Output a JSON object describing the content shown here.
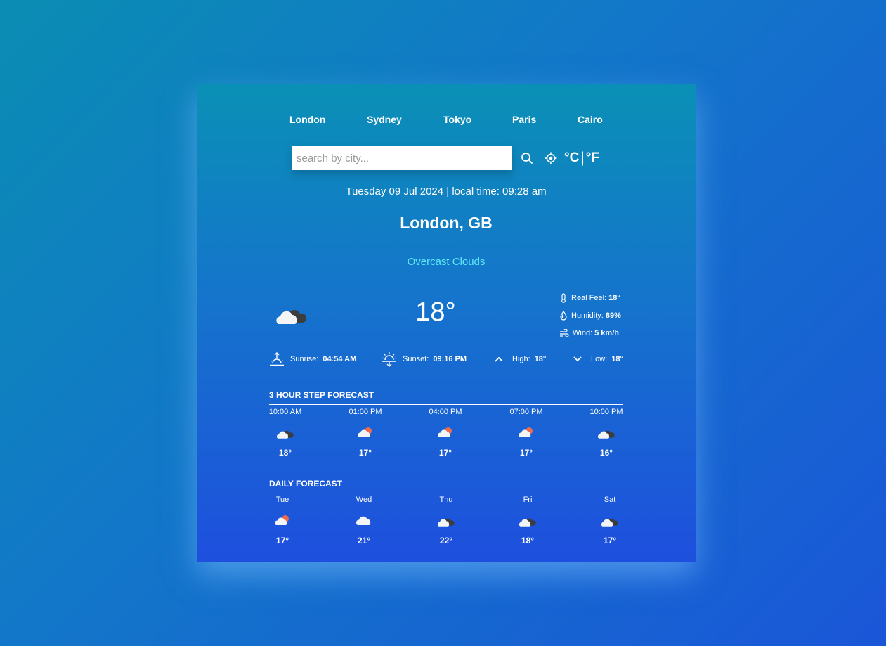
{
  "cities": [
    "London",
    "Sydney",
    "Tokyo",
    "Paris",
    "Cairo"
  ],
  "search": {
    "placeholder": "search by city..."
  },
  "units": {
    "celsius": "°C",
    "separator": "|",
    "fahrenheit": "°F"
  },
  "datetime": "Tuesday 09 Jul 2024 | local time: 09:28 am",
  "location": "London, GB",
  "condition": "Overcast Clouds",
  "current": {
    "temp": "18°",
    "icon": "overcast-clouds-icon",
    "real_feel_label": "Real Feel:",
    "real_feel": "18°",
    "humidity_label": "Humidity:",
    "humidity": "89%",
    "wind_label": "Wind:",
    "wind": "5 km/h"
  },
  "astro": {
    "sunrise_label": "Sunrise:",
    "sunrise": "04:54 AM",
    "sunset_label": "Sunset:",
    "sunset": "09:16 PM",
    "high_label": "High:",
    "high": "18°",
    "low_label": "Low:",
    "low": "18°"
  },
  "hourly": {
    "title": "3 HOUR STEP FORECAST",
    "items": [
      {
        "title": "10:00 AM",
        "icon": "overcast-clouds-icon",
        "temp": "18°"
      },
      {
        "title": "01:00 PM",
        "icon": "few-clouds-sun-icon",
        "temp": "17°"
      },
      {
        "title": "04:00 PM",
        "icon": "few-clouds-sun-icon",
        "temp": "17°"
      },
      {
        "title": "07:00 PM",
        "icon": "few-clouds-sun-icon",
        "temp": "17°"
      },
      {
        "title": "10:00 PM",
        "icon": "overcast-clouds-icon",
        "temp": "16°"
      }
    ]
  },
  "daily": {
    "title": "DAILY FORECAST",
    "items": [
      {
        "title": "Tue",
        "icon": "few-clouds-sun-icon",
        "temp": "17°"
      },
      {
        "title": "Wed",
        "icon": "cloud-icon",
        "temp": "21°"
      },
      {
        "title": "Thu",
        "icon": "overcast-clouds-icon",
        "temp": "22°"
      },
      {
        "title": "Fri",
        "icon": "overcast-clouds-icon",
        "temp": "18°"
      },
      {
        "title": "Sat",
        "icon": "overcast-clouds-icon",
        "temp": "17°"
      }
    ]
  }
}
